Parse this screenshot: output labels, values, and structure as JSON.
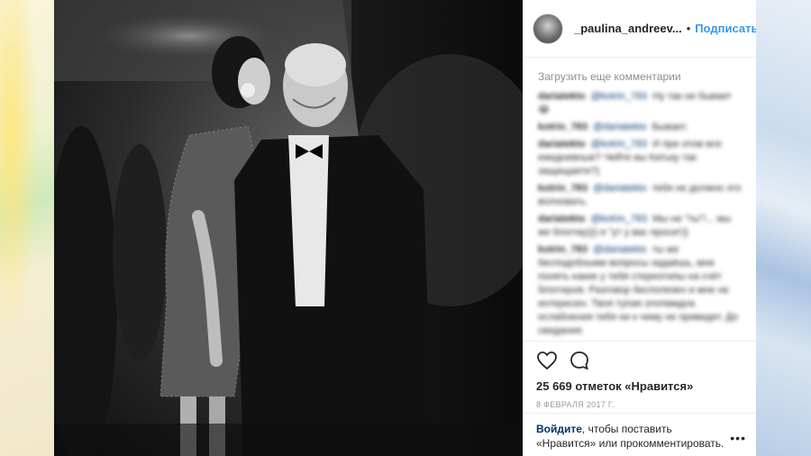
{
  "post": {
    "username": "_paulina_andreev...",
    "separator": "•",
    "follow_label": "Подписаться",
    "load_more": "Загрузить еще комментарии",
    "comments": [
      {
        "user": "dariatekto",
        "mention": "@kotrin_783",
        "text": "Ну так не бывает 😂"
      },
      {
        "user": "kotrin_783",
        "mention": "@dariatekto",
        "text": "Бывает."
      },
      {
        "user": "dariatekto",
        "mention": "@kotrin_783",
        "text": "И при этом все ежедневные? Чейте вы Катьку так защищаете?)"
      },
      {
        "user": "kotrin_783",
        "mention": "@dariatekto",
        "text": "тебя не должно это волновать."
      },
      {
        "user": "dariatekto",
        "mention": "@kotrin_783",
        "text": "Мы не \"ты\"!... мы же блоггер))) и \"ут у вас просит))"
      },
      {
        "user": "kotrin_783",
        "mention": "@dariatekto",
        "text": "ты же бесподобными вопросы задаёшь, мне понять какие у тебя стереотипы на счёт блоггеров. Разговор бесполезен и мне не интересен. Твоя тупая злопамдна ослабнения тебя ни к чему не приведет. До свидания."
      }
    ],
    "likes_text": "25 669 отметок «Нравится»",
    "date": "8 ФЕВРАЛЯ 2017 Г.",
    "login_link": "Войдите",
    "login_text_1": ", чтобы поставить",
    "login_text_2": "«Нравится» или прокомментировать.",
    "more_symbol": "•••",
    "icons": [
      "heart-icon",
      "comment-icon"
    ],
    "colors": {
      "link": "#3897f0",
      "text": "#262626",
      "muted": "#8e8e8e"
    }
  }
}
